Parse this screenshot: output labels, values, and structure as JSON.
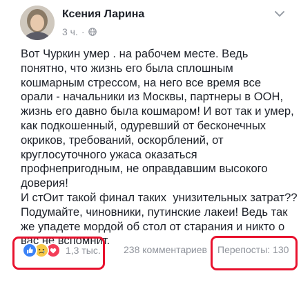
{
  "post": {
    "author": "Ксения Ларина",
    "time": "3 ч.",
    "privacy_icon": "globe-icon",
    "menu_icon": "chevron-down-icon",
    "body_lines": [
      "Вот Чуркин умер . на рабочем месте. Ведь",
      "понятно, что жизнь его была сплошным",
      "кошмарным стрессом, на него все время все",
      "орали - начальники из Москвы, партнеры в ООН,",
      "жизнь его давно была кошмаром! И вот так и умер,",
      "как подкошенный, одуревший от бесконечных",
      "окриков, требований, оскорблений, от",
      "круглосуточного ужаса оказаться",
      "профнепригодным, не оправдавшим высокого",
      "доверия!",
      "И стОит такой финал таких  унизительных затрат??",
      "Подумайте, чиновники, путинские лакеи! Ведь так",
      "же упадете мордой об стол от старания и никто о",
      "вас не вспомнит."
    ]
  },
  "footer": {
    "reactions": [
      "like-icon",
      "sad-icon",
      "love-icon"
    ],
    "reaction_count": "1,3 тыс.",
    "comments": "238 комментариев",
    "shares": "Перепосты: 130"
  },
  "colors": {
    "text": "#1d2129",
    "meta": "#90949c",
    "like": "#3b82f6",
    "sad": "#f7c948",
    "love": "#f33e58",
    "annotation": "#e8112d"
  }
}
